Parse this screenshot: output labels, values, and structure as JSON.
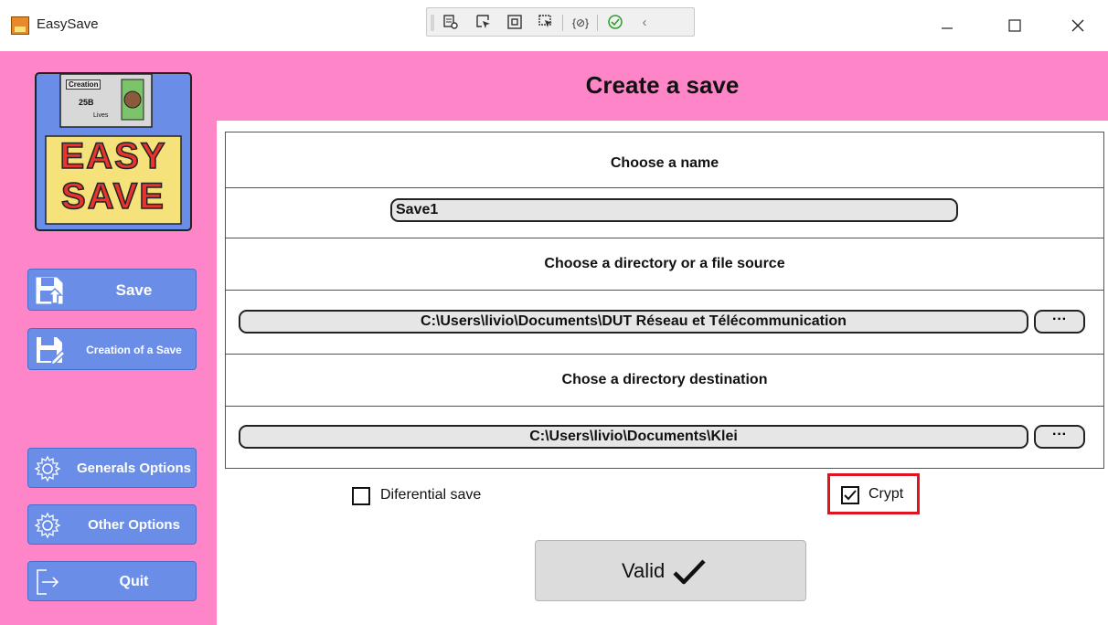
{
  "window": {
    "title": "EasySave",
    "controls": [
      "minimize-icon",
      "maximize-icon",
      "close-icon"
    ]
  },
  "debug_toolbar": {
    "icons": [
      "live-visual-tree-icon",
      "select-element-icon",
      "display-layout-adorners-icon",
      "track-focused-element-icon",
      "binding-failures-icon",
      "hot-reload-check-icon",
      "collapse-chevron-icon"
    ]
  },
  "colors": {
    "sidebar": "#fe86c8",
    "nav_button": "#6a8ee8",
    "highlight": "#e0141e"
  },
  "logo": {
    "label_lines": [
      "Creation",
      "25B",
      "Lives"
    ],
    "word1": "EASY",
    "word2": "SAVE"
  },
  "sidebar": {
    "save": "Save",
    "creation": "Creation of a Save",
    "generals_options": "Generals Options",
    "other_options": "Other Options",
    "quit": "Quit"
  },
  "page": {
    "title": "Create a save"
  },
  "form": {
    "name_label": "Choose a name",
    "name_value": "Save1",
    "source_label": "Choose a directory or a file source",
    "source_value": "C:\\Users\\livio\\Documents\\DUT Réseau et Télécommunication",
    "source_browse": "···",
    "dest_label": "Chose a directory destination",
    "dest_value": "C:\\Users\\livio\\Documents\\Klei",
    "dest_browse": "···"
  },
  "options": {
    "differential_label": "Diferential save",
    "differential_checked": false,
    "crypt_label": "Crypt",
    "crypt_checked": true
  },
  "valid_button": {
    "label": "Valid"
  }
}
